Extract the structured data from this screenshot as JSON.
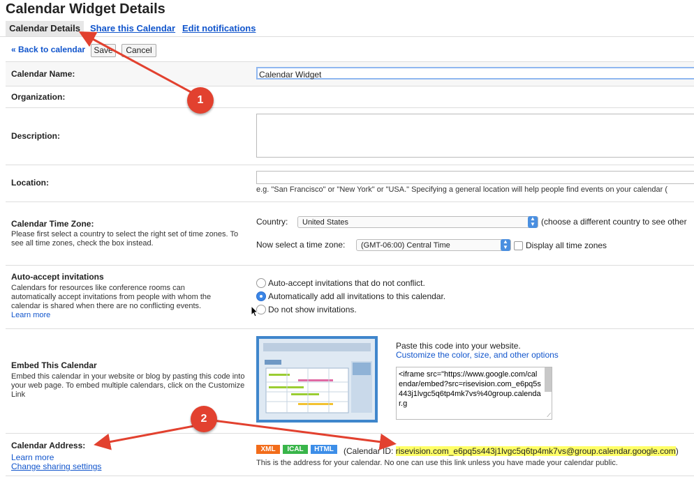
{
  "page_title": "Calendar Widget Details",
  "tabs": [
    {
      "label": "Calendar Details"
    },
    {
      "label": "Share this Calendar"
    },
    {
      "label": "Edit notifications"
    }
  ],
  "toolbar": {
    "back_label": "« Back to calendar",
    "save_label": "Save",
    "cancel_label": "Cancel"
  },
  "fields": {
    "name_label": "Calendar Name:",
    "name_value": "Calendar Widget",
    "org_label": "Organization:",
    "description_label": "Description:",
    "location_label": "Location:",
    "location_hint": "e.g. \"San Francisco\" or \"New York\" or \"USA.\" Specifying a general location will help people find events on your calendar (",
    "timezone_label": "Calendar Time Zone:",
    "timezone_help": "Please first select a country to select the right set of time zones. To see all time zones, check the box instead.",
    "country_label": "Country:",
    "country_value": "United States",
    "country_note": "(choose a different country to see other",
    "tz_label": "Now select a time zone:",
    "tz_value": "(GMT-06:00) Central Time",
    "display_all_label": "Display all time zones",
    "auto_label": "Auto-accept invitations",
    "auto_help": "Calendars for resources like conference rooms can automatically accept invitations from people with whom the calendar is shared when there are no conflicting events.",
    "learn_more": "Learn more",
    "radio_options": [
      {
        "label": "Auto-accept invitations that do not conflict.",
        "checked": false
      },
      {
        "label": "Automatically add all invitations to this calendar.",
        "checked": true
      },
      {
        "label": "Do not show invitations.",
        "checked": false
      }
    ],
    "embed_label": "Embed This Calendar",
    "embed_help": "Embed this calendar in your website or blog by pasting this code into your web page. To embed multiple calendars, click on the Customize Link",
    "embed_paste": "Paste this code into your website.",
    "embed_customize": "Customize the color, size, and other options",
    "embed_code": "<iframe src=\"https://www.google.com/calendar/embed?src=risevision.com_e6pq5s443j1lvgc5q6tp4mk7vs%40group.calendar.g",
    "address_label": "Calendar Address:",
    "address_learn_more": "Learn more",
    "address_change_sharing": "Change sharing settings",
    "badges": [
      "XML",
      "ICAL",
      "HTML"
    ],
    "calendar_id_prefix": "(Calendar ID: ",
    "calendar_id": "risevision.com_e6pq5s443j1lvgc5q6tp4mk7vs@group.calendar.google.com",
    "calendar_id_suffix": ")",
    "address_note": "This is the address for your calendar. No one can use this link unless you have made your calendar public."
  },
  "annotations": {
    "callout_1": "1",
    "callout_2": "2"
  },
  "colors": {
    "link": "#1155cc",
    "annotation": "#e2412f",
    "highlight": "#ffff66",
    "xml": "#f26c1a",
    "ical": "#39b54a",
    "html": "#3d8ee8"
  },
  "icons": [
    "select-arrows-icon",
    "mouse-cursor-icon",
    "calendar-preview-image",
    "resize-grip-icon"
  ]
}
